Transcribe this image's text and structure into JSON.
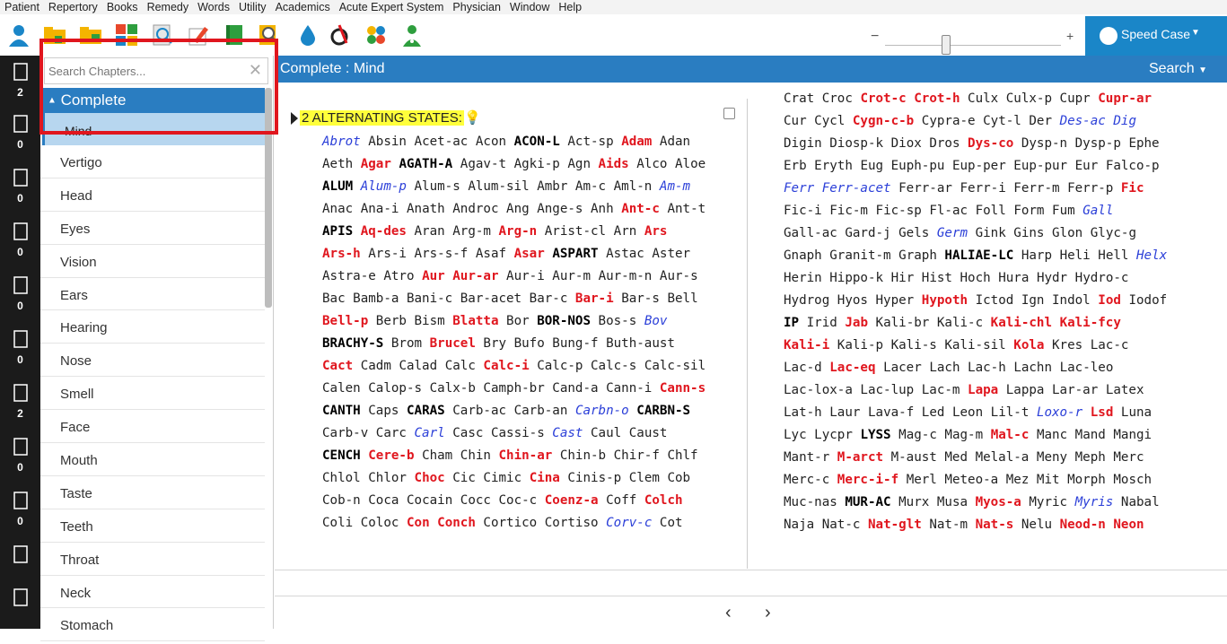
{
  "menu": [
    "Patient",
    "Repertory",
    "Books",
    "Remedy",
    "Words",
    "Utility",
    "Academics",
    "Acute Expert System",
    "Physician",
    "Window",
    "Help"
  ],
  "toolbar": {
    "icons": [
      "patient-icon",
      "open-folder-icon",
      "new-folder-icon",
      "grid-colors-icon",
      "search-doc-icon",
      "pencil-icon",
      "book-icon",
      "find-icon",
      "drop-icon",
      "rx-icon",
      "cross-icon",
      "doctor-icon"
    ],
    "zoom_minus": "−",
    "zoom_plus": "+",
    "speed_case": "Speed Case"
  },
  "rail": [
    {
      "icon": "grid-icon",
      "count": "2"
    },
    {
      "icon": "file-1-icon",
      "count": "0"
    },
    {
      "icon": "file-2-icon",
      "count": "0"
    },
    {
      "icon": "file-3-icon",
      "count": "0"
    },
    {
      "icon": "file-4-icon",
      "count": "0"
    },
    {
      "icon": "file-5-icon",
      "count": "0"
    },
    {
      "icon": "file-m-icon",
      "count": "2"
    },
    {
      "icon": "file-g-icon",
      "count": "0"
    },
    {
      "icon": "file-r-icon",
      "count": "0"
    },
    {
      "icon": "notes-icon",
      "count": ""
    },
    {
      "icon": "logout-icon",
      "count": ""
    }
  ],
  "sidebar": {
    "search_placeholder": "Search Chapters...",
    "header": "Complete",
    "selected": "Mind",
    "chapters": [
      "Vertigo",
      "Head",
      "Eyes",
      "Vision",
      "Ears",
      "Hearing",
      "Nose",
      "Smell",
      "Face",
      "Mouth",
      "Taste",
      "Teeth",
      "Throat",
      "Neck",
      "Stomach"
    ]
  },
  "titlebar": {
    "title": "Complete : Mind",
    "search": "Search"
  },
  "rubric": {
    "label": "2 ALTERNATING STATES:"
  },
  "colors": {
    "red": "#e0161e",
    "blue": "#2a7dc1",
    "italic": "#2b3fd8",
    "highlight": "#ffff3b"
  },
  "remedies_left": [
    [
      [
        "Abrot",
        "i"
      ],
      [
        "Absin",
        "p"
      ],
      [
        "Acet-ac",
        "p"
      ],
      [
        "Acon",
        "p"
      ],
      [
        "ACON-L",
        "b"
      ],
      [
        "Act-sp",
        "p"
      ],
      [
        "Adam",
        "rd"
      ],
      [
        "Adan",
        "p"
      ]
    ],
    [
      [
        "Aeth",
        "p"
      ],
      [
        "Agar",
        "rd"
      ],
      [
        "AGATH-A",
        "b"
      ],
      [
        "Agav-t",
        "p"
      ],
      [
        "Agki-p",
        "p"
      ],
      [
        "Agn",
        "p"
      ],
      [
        "Aids",
        "rd"
      ],
      [
        "Alco",
        "p"
      ],
      [
        "Aloe",
        "p"
      ]
    ],
    [
      [
        "ALUM",
        "b"
      ],
      [
        "Alum-p",
        "i"
      ],
      [
        "Alum-s",
        "p"
      ],
      [
        "Alum-sil",
        "p"
      ],
      [
        "Ambr",
        "p"
      ],
      [
        "Am-c",
        "p"
      ],
      [
        "Aml-n",
        "p"
      ],
      [
        "Am-m",
        "i"
      ]
    ],
    [
      [
        "Anac",
        "p"
      ],
      [
        "Ana-i",
        "p"
      ],
      [
        "Anath",
        "p"
      ],
      [
        "Androc",
        "p"
      ],
      [
        "Ang",
        "p"
      ],
      [
        "Ange-s",
        "p"
      ],
      [
        "Anh",
        "p"
      ],
      [
        "Ant-c",
        "rd"
      ],
      [
        "Ant-t",
        "p"
      ]
    ],
    [
      [
        "APIS",
        "b"
      ],
      [
        "Aq-des",
        "rd"
      ],
      [
        "Aran",
        "p"
      ],
      [
        "Arg-m",
        "p"
      ],
      [
        "Arg-n",
        "rd"
      ],
      [
        "Arist-cl",
        "p"
      ],
      [
        "Arn",
        "p"
      ],
      [
        "Ars",
        "rd"
      ]
    ],
    [
      [
        "Ars-h",
        "rd"
      ],
      [
        "Ars-i",
        "p"
      ],
      [
        "Ars-s-f",
        "p"
      ],
      [
        "Asaf",
        "p"
      ],
      [
        "Asar",
        "rd"
      ],
      [
        "ASPART",
        "b"
      ],
      [
        "Astac",
        "p"
      ],
      [
        "Aster",
        "p"
      ]
    ],
    [
      [
        "Astra-e",
        "p"
      ],
      [
        "Atro",
        "p"
      ],
      [
        "Aur",
        "rd"
      ],
      [
        "Aur-ar",
        "rd"
      ],
      [
        "Aur-i",
        "p"
      ],
      [
        "Aur-m",
        "p"
      ],
      [
        "Aur-m-n",
        "p"
      ],
      [
        "Aur-s",
        "p"
      ]
    ],
    [
      [
        "Bac",
        "p"
      ],
      [
        "Bamb-a",
        "p"
      ],
      [
        "Bani-c",
        "p"
      ],
      [
        "Bar-acet",
        "p"
      ],
      [
        "Bar-c",
        "p"
      ],
      [
        "Bar-i",
        "rd"
      ],
      [
        "Bar-s",
        "p"
      ],
      [
        "Bell",
        "p"
      ]
    ],
    [
      [
        "Bell-p",
        "rd"
      ],
      [
        "Berb",
        "p"
      ],
      [
        "Bism",
        "p"
      ],
      [
        "Blatta",
        "rd"
      ],
      [
        "Bor",
        "p"
      ],
      [
        "BOR-NOS",
        "b"
      ],
      [
        "Bos-s",
        "p"
      ],
      [
        "Bov",
        "i"
      ]
    ],
    [
      [
        "BRACHY-S",
        "b"
      ],
      [
        "Brom",
        "p"
      ],
      [
        "Brucel",
        "rd"
      ],
      [
        "Bry",
        "p"
      ],
      [
        "Bufo",
        "p"
      ],
      [
        "Bung-f",
        "p"
      ],
      [
        "Buth-aust",
        "p"
      ]
    ],
    [
      [
        "Cact",
        "rd"
      ],
      [
        "Cadm",
        "p"
      ],
      [
        "Calad",
        "p"
      ],
      [
        "Calc",
        "p"
      ],
      [
        "Calc-i",
        "rd"
      ],
      [
        "Calc-p",
        "p"
      ],
      [
        "Calc-s",
        "p"
      ],
      [
        "Calc-sil",
        "p"
      ]
    ],
    [
      [
        "Calen",
        "p"
      ],
      [
        "Calop-s",
        "p"
      ],
      [
        "Calx-b",
        "p"
      ],
      [
        "Camph-br",
        "p"
      ],
      [
        "Cand-a",
        "p"
      ],
      [
        "Cann-i",
        "p"
      ],
      [
        "Cann-s",
        "rd"
      ]
    ],
    [
      [
        "CANTH",
        "b"
      ],
      [
        "Caps",
        "p"
      ],
      [
        "CARAS",
        "b"
      ],
      [
        "Carb-ac",
        "p"
      ],
      [
        "Carb-an",
        "p"
      ],
      [
        "Carbn-o",
        "i"
      ],
      [
        "CARBN-S",
        "b"
      ]
    ],
    [
      [
        "Carb-v",
        "p"
      ],
      [
        "Carc",
        "p"
      ],
      [
        "Carl",
        "i"
      ],
      [
        "Casc",
        "p"
      ],
      [
        "Cassi-s",
        "p"
      ],
      [
        "Cast",
        "i"
      ],
      [
        "Caul",
        "p"
      ],
      [
        "Caust",
        "p"
      ]
    ],
    [
      [
        "CENCH",
        "b"
      ],
      [
        "Cere-b",
        "rd"
      ],
      [
        "Cham",
        "p"
      ],
      [
        "Chin",
        "p"
      ],
      [
        "Chin-ar",
        "rd"
      ],
      [
        "Chin-b",
        "p"
      ],
      [
        "Chir-f",
        "p"
      ],
      [
        "Chlf",
        "p"
      ]
    ],
    [
      [
        "Chlol",
        "p"
      ],
      [
        "Chlor",
        "p"
      ],
      [
        "Choc",
        "rd"
      ],
      [
        "Cic",
        "p"
      ],
      [
        "Cimic",
        "p"
      ],
      [
        "Cina",
        "rd"
      ],
      [
        "Cinis-p",
        "p"
      ],
      [
        "Clem",
        "p"
      ],
      [
        "Cob",
        "p"
      ]
    ],
    [
      [
        "Cob-n",
        "p"
      ],
      [
        "Coca",
        "p"
      ],
      [
        "Cocain",
        "p"
      ],
      [
        "Cocc",
        "p"
      ],
      [
        "Coc-c",
        "p"
      ],
      [
        "Coenz-a",
        "rd"
      ],
      [
        "Coff",
        "p"
      ],
      [
        "Colch",
        "rd"
      ]
    ],
    [
      [
        "Coli",
        "p"
      ],
      [
        "Coloc",
        "p"
      ],
      [
        "Con",
        "rd"
      ],
      [
        "Conch",
        "rd"
      ],
      [
        "Cortico",
        "p"
      ],
      [
        "Cortiso",
        "p"
      ],
      [
        "Corv-c",
        "i"
      ],
      [
        "Cot",
        "p"
      ]
    ]
  ],
  "remedies_right": [
    [
      [
        "Crat",
        "p"
      ],
      [
        "Croc",
        "p"
      ],
      [
        "Crot-c",
        "rd"
      ],
      [
        "Crot-h",
        "rd"
      ],
      [
        "Culx",
        "p"
      ],
      [
        "Culx-p",
        "p"
      ],
      [
        "Cupr",
        "p"
      ],
      [
        "Cupr-ar",
        "rd"
      ]
    ],
    [
      [
        "Cur",
        "p"
      ],
      [
        "Cycl",
        "p"
      ],
      [
        "Cygn-c-b",
        "rd"
      ],
      [
        "Cypra-e",
        "p"
      ],
      [
        "Cyt-l",
        "p"
      ],
      [
        "Der",
        "p"
      ],
      [
        "Des-ac",
        "i"
      ],
      [
        "Dig",
        "i"
      ]
    ],
    [
      [
        "Digin",
        "p"
      ],
      [
        "Diosp-k",
        "p"
      ],
      [
        "Diox",
        "p"
      ],
      [
        "Dros",
        "p"
      ],
      [
        "Dys-co",
        "rd"
      ],
      [
        "Dysp-n",
        "p"
      ],
      [
        "Dysp-p",
        "p"
      ],
      [
        "Ephe",
        "p"
      ]
    ],
    [
      [
        "Erb",
        "p"
      ],
      [
        "Eryth",
        "p"
      ],
      [
        "Eug",
        "p"
      ],
      [
        "Euph-pu",
        "p"
      ],
      [
        "Eup-per",
        "p"
      ],
      [
        "Eup-pur",
        "p"
      ],
      [
        "Eur",
        "p"
      ],
      [
        "Falco-p",
        "p"
      ]
    ],
    [
      [
        "Ferr",
        "i"
      ],
      [
        "Ferr-acet",
        "i"
      ],
      [
        "Ferr-ar",
        "p"
      ],
      [
        "Ferr-i",
        "p"
      ],
      [
        "Ferr-m",
        "p"
      ],
      [
        "Ferr-p",
        "p"
      ],
      [
        "Fic",
        "rd"
      ]
    ],
    [
      [
        "Fic-i",
        "p"
      ],
      [
        "Fic-m",
        "p"
      ],
      [
        "Fic-sp",
        "p"
      ],
      [
        "Fl-ac",
        "p"
      ],
      [
        "Foll",
        "p"
      ],
      [
        "Form",
        "p"
      ],
      [
        "Fum",
        "p"
      ],
      [
        "Gall",
        "i"
      ]
    ],
    [
      [
        "Gall-ac",
        "p"
      ],
      [
        "Gard-j",
        "p"
      ],
      [
        "Gels",
        "p"
      ],
      [
        "Germ",
        "i"
      ],
      [
        "Gink",
        "p"
      ],
      [
        "Gins",
        "p"
      ],
      [
        "Glon",
        "p"
      ],
      [
        "Glyc-g",
        "p"
      ]
    ],
    [
      [
        "Gnaph",
        "p"
      ],
      [
        "Granit-m",
        "p"
      ],
      [
        "Graph",
        "p"
      ],
      [
        "HALIAE-LC",
        "b"
      ],
      [
        "Harp",
        "p"
      ],
      [
        "Heli",
        "p"
      ],
      [
        "Hell",
        "p"
      ],
      [
        "Helx",
        "i"
      ]
    ],
    [
      [
        "Herin",
        "p"
      ],
      [
        "Hippo-k",
        "p"
      ],
      [
        "Hir",
        "p"
      ],
      [
        "Hist",
        "p"
      ],
      [
        "Hoch",
        "p"
      ],
      [
        "Hura",
        "p"
      ],
      [
        "Hydr",
        "p"
      ],
      [
        "Hydro-c",
        "p"
      ]
    ],
    [
      [
        "Hydrog",
        "p"
      ],
      [
        "Hyos",
        "p"
      ],
      [
        "Hyper",
        "p"
      ],
      [
        "Hypoth",
        "rd"
      ],
      [
        "Ictod",
        "p"
      ],
      [
        "Ign",
        "p"
      ],
      [
        "Indol",
        "p"
      ],
      [
        "Iod",
        "rd"
      ],
      [
        "Iodof",
        "p"
      ]
    ],
    [
      [
        "IP",
        "b"
      ],
      [
        "Irid",
        "p"
      ],
      [
        "Jab",
        "rd"
      ],
      [
        "Kali-br",
        "p"
      ],
      [
        "Kali-c",
        "p"
      ],
      [
        "Kali-chl",
        "rd"
      ],
      [
        "Kali-fcy",
        "rd"
      ]
    ],
    [
      [
        "Kali-i",
        "rd"
      ],
      [
        "Kali-p",
        "p"
      ],
      [
        "Kali-s",
        "p"
      ],
      [
        "Kali-sil",
        "p"
      ],
      [
        "Kola",
        "rd"
      ],
      [
        "Kres",
        "p"
      ],
      [
        "Lac-c",
        "p"
      ]
    ],
    [
      [
        "Lac-d",
        "p"
      ],
      [
        "Lac-eq",
        "rd"
      ],
      [
        "Lacer",
        "p"
      ],
      [
        "Lach",
        "p"
      ],
      [
        "Lac-h",
        "p"
      ],
      [
        "Lachn",
        "p"
      ],
      [
        "Lac-leo",
        "p"
      ]
    ],
    [
      [
        "Lac-lox-a",
        "p"
      ],
      [
        "Lac-lup",
        "p"
      ],
      [
        "Lac-m",
        "p"
      ],
      [
        "Lapa",
        "rd"
      ],
      [
        "Lappa",
        "p"
      ],
      [
        "Lar-ar",
        "p"
      ],
      [
        "Latex",
        "p"
      ]
    ],
    [
      [
        "Lat-h",
        "p"
      ],
      [
        "Laur",
        "p"
      ],
      [
        "Lava-f",
        "p"
      ],
      [
        "Led",
        "p"
      ],
      [
        "Leon",
        "p"
      ],
      [
        "Lil-t",
        "p"
      ],
      [
        "Loxo-r",
        "i"
      ],
      [
        "Lsd",
        "rd"
      ],
      [
        "Luna",
        "p"
      ]
    ],
    [
      [
        "Lyc",
        "p"
      ],
      [
        "Lycpr",
        "p"
      ],
      [
        "LYSS",
        "b"
      ],
      [
        "Mag-c",
        "p"
      ],
      [
        "Mag-m",
        "p"
      ],
      [
        "Mal-c",
        "rd"
      ],
      [
        "Manc",
        "p"
      ],
      [
        "Mand",
        "p"
      ],
      [
        "Mangi",
        "p"
      ]
    ],
    [
      [
        "Mant-r",
        "p"
      ],
      [
        "M-arct",
        "rd"
      ],
      [
        "M-aust",
        "p"
      ],
      [
        "Med",
        "p"
      ],
      [
        "Melal-a",
        "p"
      ],
      [
        "Meny",
        "p"
      ],
      [
        "Meph",
        "p"
      ],
      [
        "Merc",
        "p"
      ]
    ],
    [
      [
        "Merc-c",
        "p"
      ],
      [
        "Merc-i-f",
        "rd"
      ],
      [
        "Merl",
        "p"
      ],
      [
        "Meteo-a",
        "p"
      ],
      [
        "Mez",
        "p"
      ],
      [
        "Mit",
        "p"
      ],
      [
        "Morph",
        "p"
      ],
      [
        "Mosch",
        "p"
      ]
    ],
    [
      [
        "Muc-nas",
        "p"
      ],
      [
        "MUR-AC",
        "b"
      ],
      [
        "Murx",
        "p"
      ],
      [
        "Musa",
        "p"
      ],
      [
        "Myos-a",
        "rd"
      ],
      [
        "Myric",
        "p"
      ],
      [
        "Myris",
        "i"
      ],
      [
        "Nabal",
        "p"
      ]
    ],
    [
      [
        "Naja",
        "p"
      ],
      [
        "Nat-c",
        "p"
      ],
      [
        "Nat-glt",
        "rd"
      ],
      [
        "Nat-m",
        "p"
      ],
      [
        "Nat-s",
        "rd"
      ],
      [
        "Nelu",
        "p"
      ],
      [
        "Neod-n",
        "rd"
      ],
      [
        "Neon",
        "rd"
      ]
    ]
  ]
}
